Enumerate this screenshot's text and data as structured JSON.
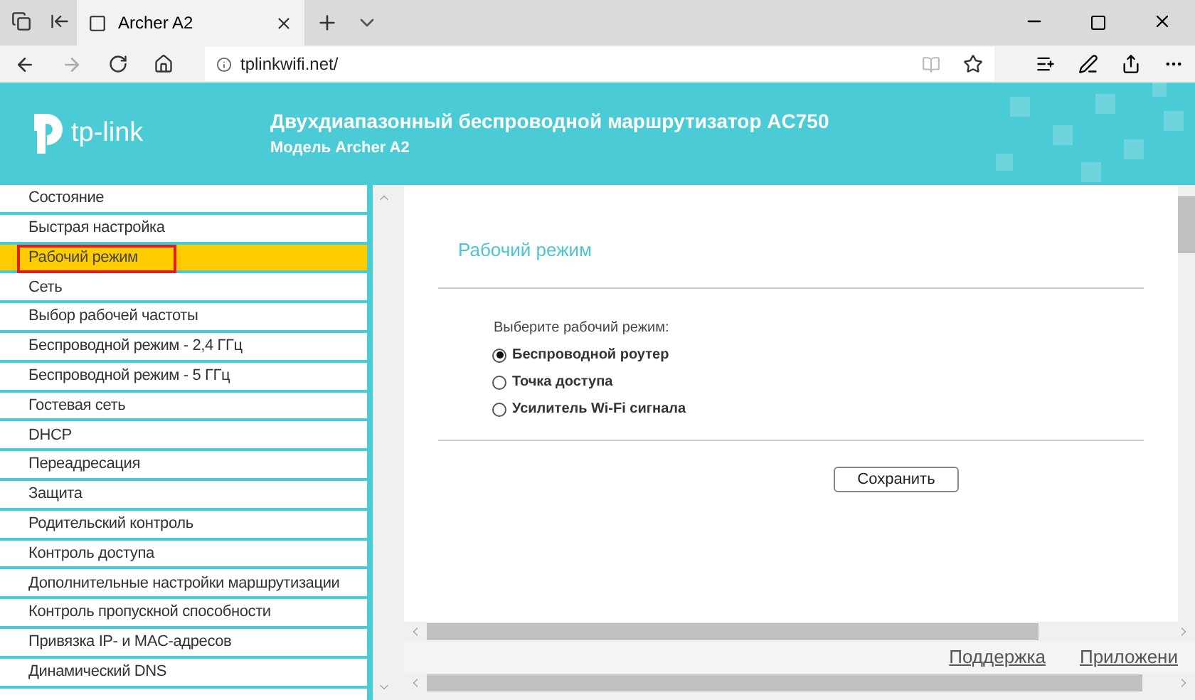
{
  "browser": {
    "tab_title": "Archer A2",
    "address": "tplinkwifi.net/"
  },
  "header": {
    "logo": "tp-link",
    "title": "Двухдиапазонный беспроводной маршрутизатор AC750",
    "subtitle": "Модель Archer A2"
  },
  "sidebar": {
    "items": [
      {
        "label": "Состояние",
        "selected": false
      },
      {
        "label": "Быстрая настройка",
        "selected": false
      },
      {
        "label": "Рабочий режим",
        "selected": true
      },
      {
        "label": "Сеть",
        "selected": false
      },
      {
        "label": "Выбор рабочей частоты",
        "selected": false
      },
      {
        "label": "Беспроводной режим - 2,4 ГГц",
        "selected": false
      },
      {
        "label": "Беспроводной режим - 5 ГГц",
        "selected": false
      },
      {
        "label": "Гостевая сеть",
        "selected": false
      },
      {
        "label": "DHCP",
        "selected": false
      },
      {
        "label": "Переадресация",
        "selected": false
      },
      {
        "label": "Защита",
        "selected": false
      },
      {
        "label": "Родительский контроль",
        "selected": false
      },
      {
        "label": "Контроль доступа",
        "selected": false
      },
      {
        "label": "Дополнительные настройки маршрутизации",
        "selected": false
      },
      {
        "label": "Контроль пропускной способности",
        "selected": false
      },
      {
        "label": "Привязка IP- и MAC-адресов",
        "selected": false
      },
      {
        "label": "Динамический DNS",
        "selected": false
      }
    ]
  },
  "content": {
    "title": "Рабочий режим",
    "prompt": "Выберите рабочий режим:",
    "modes": [
      {
        "label": "Беспроводной роутер",
        "selected": true
      },
      {
        "label": "Точка доступа",
        "selected": false
      },
      {
        "label": "Усилитель Wi-Fi сигнала",
        "selected": false
      }
    ],
    "save_button": "Сохранить"
  },
  "footer": {
    "links": [
      "Поддержка",
      "Приложени"
    ]
  }
}
